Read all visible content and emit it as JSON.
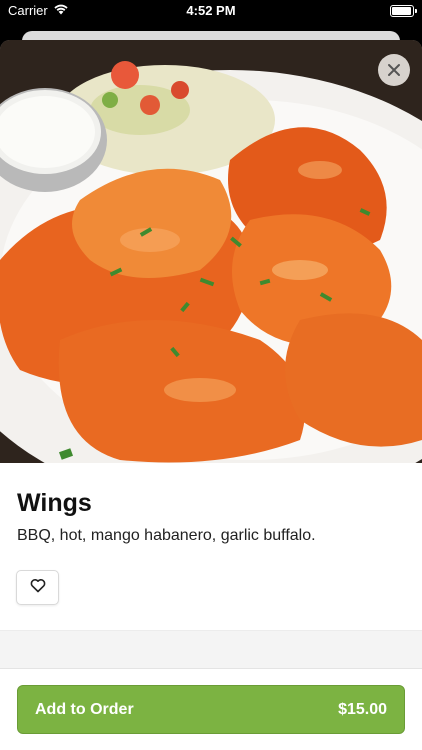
{
  "status_bar": {
    "carrier": "Carrier",
    "time": "4:52 PM",
    "battery_level": 1.0
  },
  "item": {
    "name": "Wings",
    "description": "BBQ, hot, mango habanero, garlic buffalo.",
    "image_alt": "Chicken wings with sauce, dip and slaw"
  },
  "icons": {
    "close": "close-icon",
    "favorite": "heart-outline-icon",
    "wifi": "wifi-icon",
    "battery": "battery-icon"
  },
  "actions": {
    "add_label": "Add to Order",
    "price": "$15.00"
  },
  "colors": {
    "accent": "#7cb342",
    "accent_border": "#6a9c36",
    "title": "#111111"
  }
}
